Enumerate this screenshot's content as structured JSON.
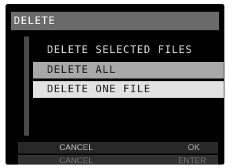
{
  "title": "DELETE",
  "menu": {
    "items": [
      {
        "label": "DELETE SELECTED FILES"
      },
      {
        "label": "DELETE ALL"
      },
      {
        "label": "DELETE ONE FILE"
      }
    ]
  },
  "footer": {
    "top": {
      "left": "CANCEL",
      "right": "OK"
    },
    "bottom": {
      "left": "CANCEL",
      "right": "ENTER"
    }
  },
  "colors": {
    "background": "#000000",
    "title_bar": "#6a6a6a",
    "menu_item_focused": "#e2e2e2",
    "menu_item_selected": "#a8a8a8",
    "footer_bar": "#282828"
  }
}
